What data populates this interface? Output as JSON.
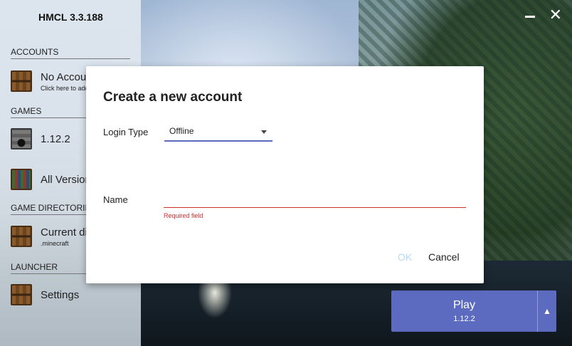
{
  "app": {
    "title": "HMCL 3.3.188"
  },
  "window_controls": {
    "minimize_icon": "minimize-icon",
    "close_icon": "close-icon",
    "close_glyph": "✕"
  },
  "sidebar": {
    "sections": {
      "accounts": "ACCOUNTS",
      "games": "GAMES",
      "game_directories": "GAME DIRECTORIES",
      "launcher": "LAUNCHER"
    },
    "items": {
      "account": {
        "label": "No Account",
        "sub": "Click here to add an account",
        "icon": "chest-icon"
      },
      "version": {
        "label": "1.12.2",
        "icon": "furnace-icon"
      },
      "all_versions": {
        "label": "All Versions",
        "icon": "bookshelf-icon"
      },
      "directory": {
        "label": "Current directory",
        "sub": ".minecraft",
        "icon": "chest-icon"
      },
      "settings": {
        "label": "Settings",
        "icon": "chest-icon"
      }
    }
  },
  "play": {
    "label": "Play",
    "version": "1.12.2",
    "arrow": "▲"
  },
  "dialog": {
    "title": "Create a new account",
    "login_type_label": "Login Type",
    "login_type_value": "Offline",
    "name_label": "Name",
    "name_value": "",
    "name_error": "Required field",
    "ok_label": "OK",
    "cancel_label": "Cancel"
  },
  "colors": {
    "accent": "#5c6bc0",
    "error": "#d32f2f",
    "ok_disabled": "#b3dbf5"
  }
}
